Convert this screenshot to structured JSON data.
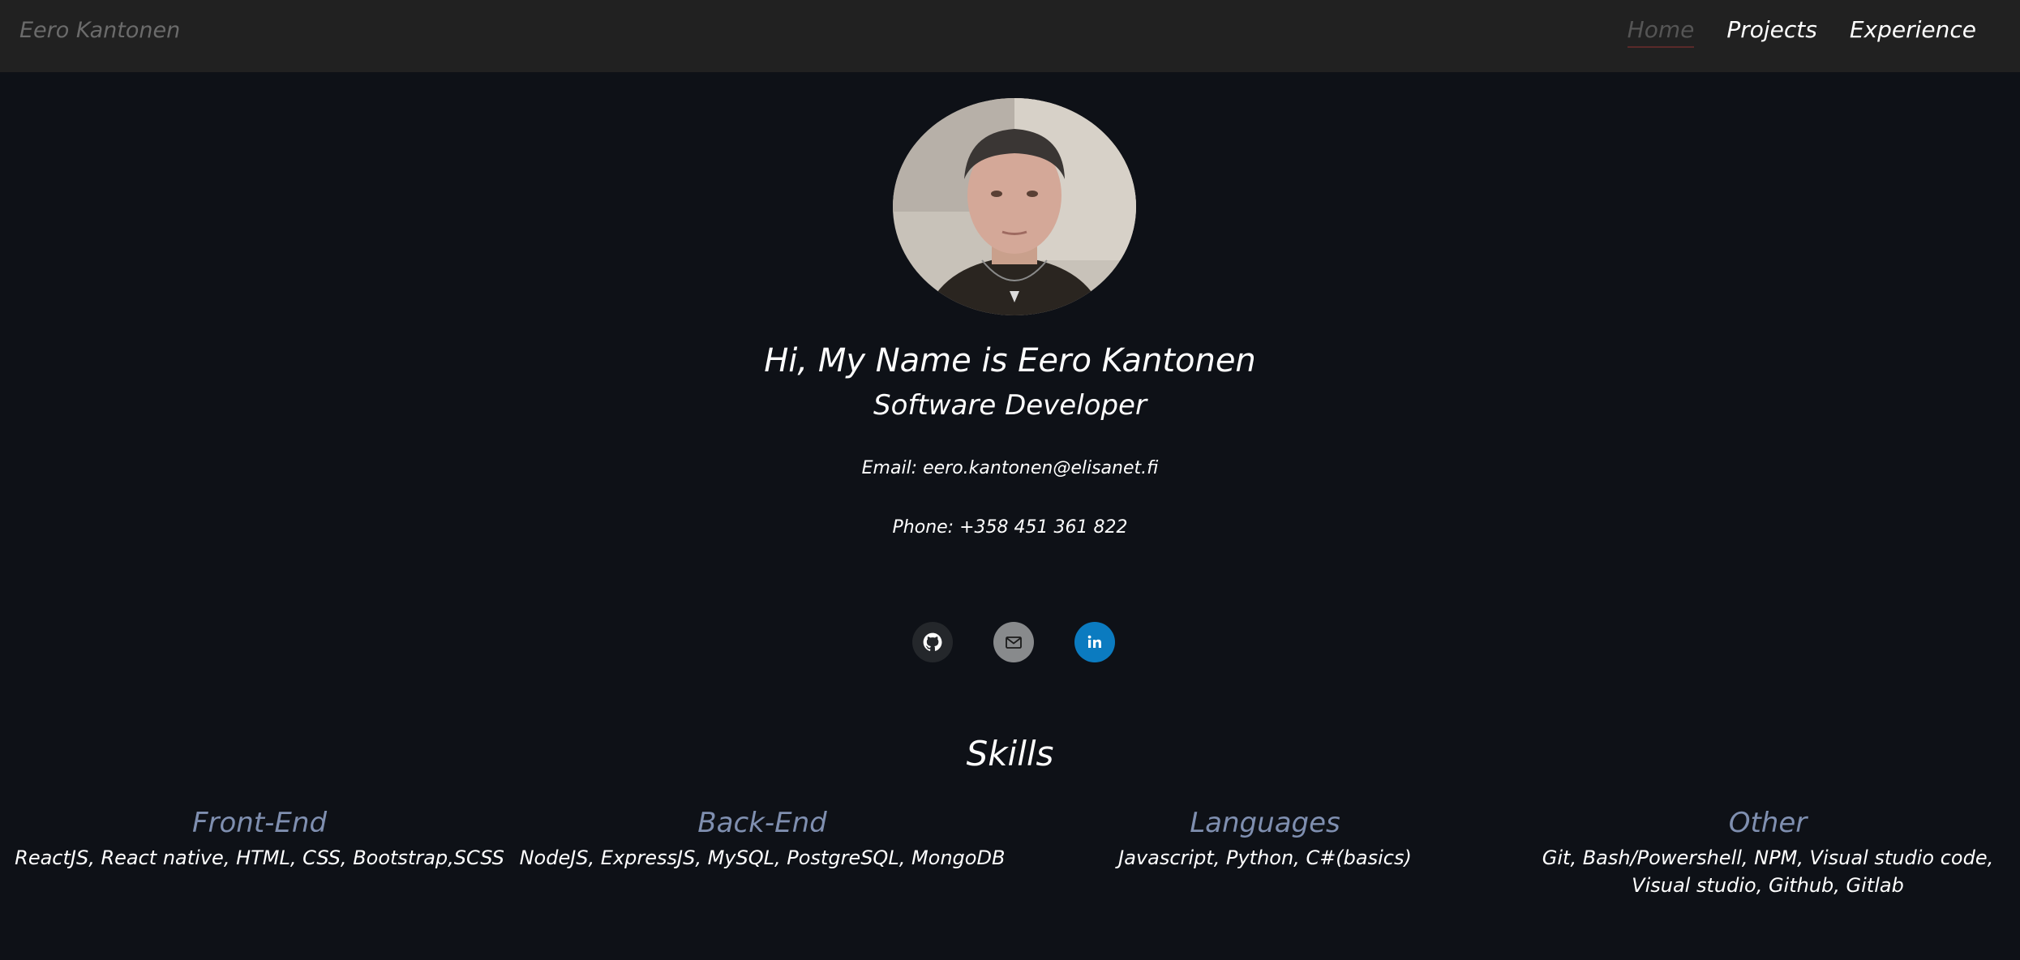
{
  "nav": {
    "brand": "Eero Kantonen",
    "links": [
      "Home",
      "Projects",
      "Experience"
    ]
  },
  "hero": {
    "title": "Hi, My Name is Eero Kantonen",
    "subtitle": "Software Developer",
    "email": "Email: eero.kantonen@elisanet.fi",
    "phone": "Phone: +358 451 361 822"
  },
  "socials": [
    "github-icon",
    "mail-icon",
    "linkedin-icon"
  ],
  "skills": {
    "title": "Skills",
    "categories": [
      {
        "heading": "Front-End",
        "items": "ReactJS, React native, HTML, CSS, Bootstrap,SCSS"
      },
      {
        "heading": "Back-End",
        "items": "NodeJS, ExpressJS, MySQL, PostgreSQL, MongoDB"
      },
      {
        "heading": "Languages",
        "items": "Javascript, Python, C#(basics)"
      },
      {
        "heading": "Other",
        "items": "Git, Bash/Powershell, NPM, Visual studio code, Visual studio, Github, Gitlab"
      }
    ]
  },
  "colors": {
    "background": "#0e1117",
    "navbar": "#212121",
    "skill_heading": "#7f8fb0",
    "linkedin": "#0b7bc0"
  }
}
